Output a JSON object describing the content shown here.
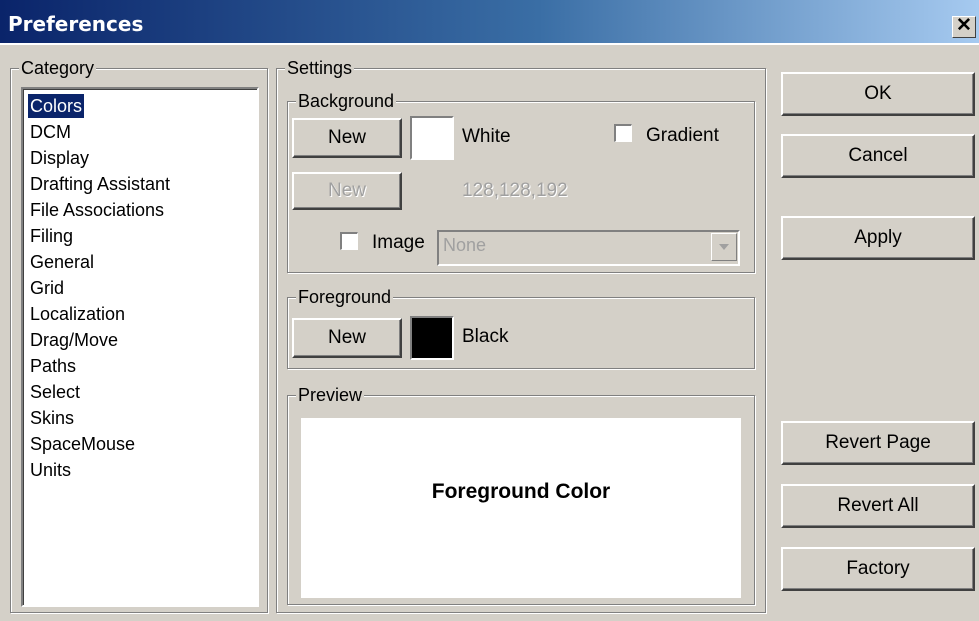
{
  "window": {
    "title": "Preferences"
  },
  "category": {
    "legend": "Category",
    "items": [
      "Colors",
      "DCM",
      "Display",
      "Drafting Assistant",
      "File Associations",
      "Filing",
      "General",
      "Grid",
      "Localization",
      "Drag/Move",
      "Paths",
      "Select",
      "Skins",
      "SpaceMouse",
      "Units"
    ],
    "selected": "Colors"
  },
  "settings": {
    "legend": "Settings",
    "background": {
      "legend": "Background",
      "new_label": "New",
      "color_name": "White",
      "color_hex": "#ffffff",
      "gradient_label": "Gradient",
      "gradient_checked": false,
      "new2_label": "New",
      "gradient_color": "128,128,192",
      "image_label": "Image",
      "image_checked": false,
      "image_value": "None"
    },
    "foreground": {
      "legend": "Foreground",
      "new_label": "New",
      "color_name": "Black",
      "color_hex": "#000000"
    },
    "preview": {
      "legend": "Preview",
      "text": "Foreground Color"
    }
  },
  "actions": {
    "ok": "OK",
    "cancel": "Cancel",
    "apply": "Apply",
    "revert_page": "Revert Page",
    "revert_all": "Revert All",
    "factory": "Factory"
  }
}
